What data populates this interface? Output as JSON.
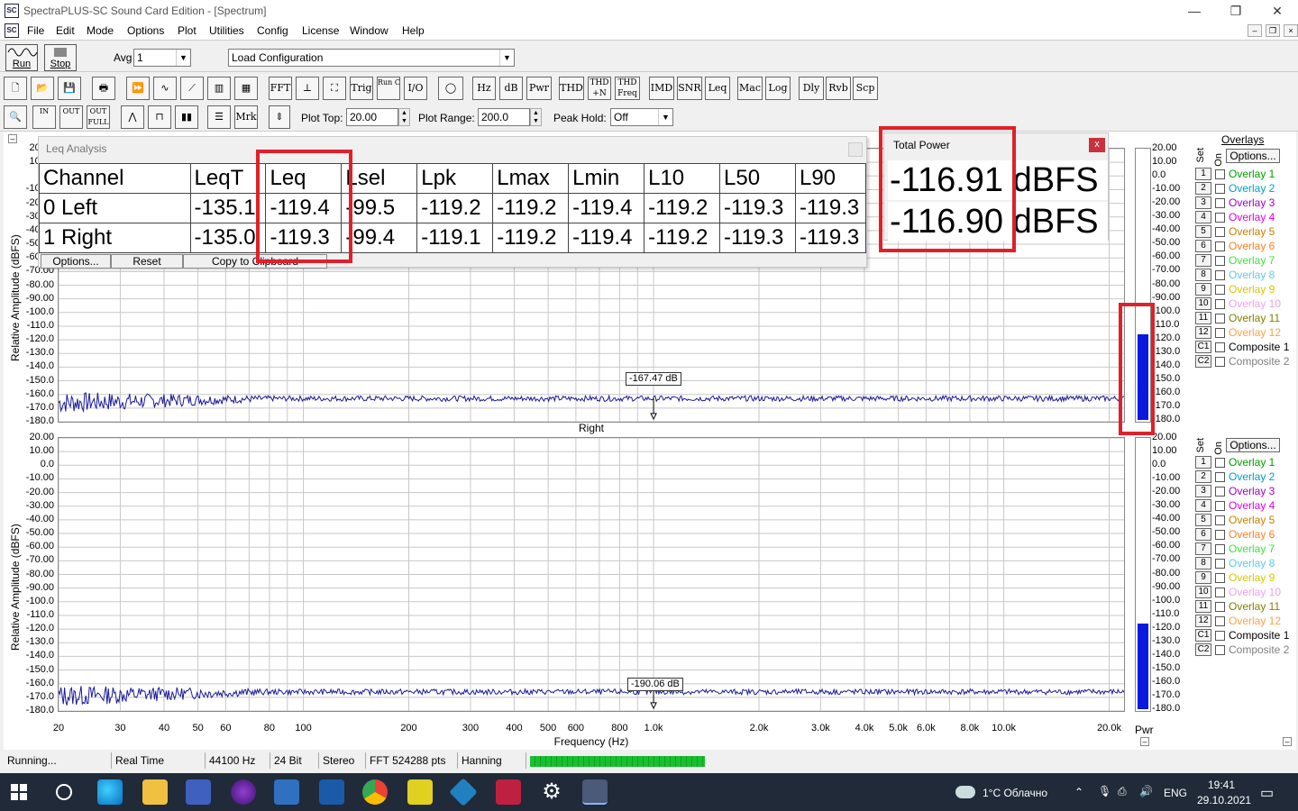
{
  "window": {
    "title": "SpectraPLUS-SC Sound Card Edition - [Spectrum]",
    "minimize": "—",
    "maximize": "❐",
    "close": "✕"
  },
  "menu": [
    "File",
    "Edit",
    "Mode",
    "Options",
    "Plot",
    "Utilities",
    "Config",
    "License",
    "Window",
    "Help"
  ],
  "toolbar1": {
    "run": "Run",
    "stop": "Stop",
    "avg_label": "Avg",
    "avg_value": "1",
    "config_value": "Load Configuration"
  },
  "toolbar2": [
    "FFT",
    "Trig",
    "Run Ctrl",
    "I/O",
    "Hz",
    "dB",
    "Pwr",
    "THD",
    "THD +N",
    "THD Freq",
    "IMD",
    "SNR",
    "Leq",
    "Mac",
    "Log",
    "Dly",
    "Rvb",
    "Scp"
  ],
  "toolbar3": {
    "zoom_in": "IN",
    "zoom_out": "OUT",
    "zoom_full": "OUT FULL",
    "mrk": "Mrk",
    "plot_top_label": "Plot Top:",
    "plot_top": "20.00",
    "plot_range_label": "Plot Range:",
    "plot_range": "200.0",
    "peak_hold_label": "Peak Hold:",
    "peak_hold": "Off"
  },
  "plots": {
    "yaxis_title": "Relative Amplitude (dBFS)",
    "xaxis_title": "Frequency (Hz)",
    "right_title": "Right",
    "y_ticks": [
      "20.00",
      "10.00",
      "0.0",
      "-10.00",
      "-20.00",
      "-30.00",
      "-40.00",
      "-50.00",
      "-60.00",
      "-70.00",
      "-80.00",
      "-90.00",
      "-100.0",
      "-110.0",
      "-120.0",
      "-130.0",
      "-140.0",
      "-150.0",
      "-160.0",
      "-170.0",
      "-180.0"
    ],
    "x_ticks": [
      "20",
      "30",
      "40",
      "50",
      "60",
      "80",
      "100",
      "200",
      "300",
      "400",
      "500",
      "600",
      "800",
      "1.0k",
      "2.0k",
      "3.0k",
      "4.0k",
      "5.0k",
      "6.0k",
      "8.0k",
      "10.0k",
      "20.0k"
    ],
    "x_tick_hz": [
      20,
      30,
      40,
      50,
      60,
      80,
      100,
      200,
      300,
      400,
      500,
      600,
      800,
      1000,
      2000,
      3000,
      4000,
      5000,
      6000,
      8000,
      10000,
      20000
    ],
    "x_range_hz": [
      20,
      22050
    ],
    "y_range": [
      -180,
      20
    ],
    "marker_top": "-167.47 dB",
    "marker_top_hz": 1000,
    "marker_bottom": "-190.06 dB",
    "marker_bottom_hz": 1000,
    "trace_color": "#1a1a9c",
    "noise_level_top": -163,
    "noise_level_bottom": -166
  },
  "power_meter": {
    "label": "Pwr",
    "ticks": [
      "20.00",
      "10.00",
      "0.0",
      "-10.00",
      "-20.00",
      "-30.00",
      "-40.00",
      "-50.00",
      "-60.00",
      "-70.00",
      "-80.00",
      "-90.00",
      "-100.0",
      "-110.0",
      "-120.0",
      "-130.0",
      "-140.0",
      "-150.0",
      "-160.0",
      "-170.0",
      "-180.0"
    ],
    "top_level_db": -116.9,
    "bottom_level_db": -116.9,
    "fill_color": "#0b19e0"
  },
  "overlays": {
    "title": "Overlays",
    "set_label": "Set",
    "on_label": "On",
    "options": "Options...",
    "items": [
      {
        "num": "1",
        "label": "Overlay 1",
        "color": "#00a000"
      },
      {
        "num": "2",
        "label": "Overlay 2",
        "color": "#00a0c8"
      },
      {
        "num": "3",
        "label": "Overlay 3",
        "color": "#a000c8"
      },
      {
        "num": "4",
        "label": "Overlay 4",
        "color": "#e000e0"
      },
      {
        "num": "5",
        "label": "Overlay 5",
        "color": "#c88000"
      },
      {
        "num": "6",
        "label": "Overlay 6",
        "color": "#ff8020"
      },
      {
        "num": "7",
        "label": "Overlay 7",
        "color": "#40e040"
      },
      {
        "num": "8",
        "label": "Overlay 8",
        "color": "#60c8f0"
      },
      {
        "num": "9",
        "label": "Overlay 9",
        "color": "#d8c800"
      },
      {
        "num": "10",
        "label": "Overlay 10",
        "color": "#f0a0f0"
      },
      {
        "num": "11",
        "label": "Overlay 11",
        "color": "#808000"
      },
      {
        "num": "12",
        "label": "Overlay 12",
        "color": "#ffa040"
      },
      {
        "num": "C1",
        "label": "Composite 1",
        "color": "#000000"
      },
      {
        "num": "C2",
        "label": "Composite 2",
        "color": "#808080"
      }
    ]
  },
  "leq": {
    "title": "Leq Analysis",
    "headers": [
      "Channel",
      "LeqT",
      "Leq",
      "Lsel",
      "Lpk",
      "Lmax",
      "Lmin",
      "L10",
      "L50",
      "L90"
    ],
    "rows": [
      [
        "0 Left",
        "-135.1",
        "-119.4",
        "-99.5",
        "-119.2",
        "-119.2",
        "-119.4",
        "-119.2",
        "-119.3",
        "-119.3"
      ],
      [
        "1 Right",
        "-135.0",
        "-119.3",
        "-99.4",
        "-119.1",
        "-119.2",
        "-119.4",
        "-119.2",
        "-119.3",
        "-119.3"
      ]
    ],
    "buttons": [
      "Options...",
      "Reset",
      "Copy to Clipboard"
    ]
  },
  "total_power": {
    "title": "Total Power",
    "close": "x",
    "value_left": "-116.91 dBFS",
    "value_right": "-116.90 dBFS"
  },
  "status": [
    "Running...",
    "Real Time",
    "44100 Hz",
    "24 Bit",
    "Stereo",
    "FFT 524288 pts",
    "Hanning"
  ],
  "tray": {
    "weather": "1°C  Облачно",
    "lang": "ENG",
    "time": "19:41",
    "date": "29.10.2021"
  }
}
